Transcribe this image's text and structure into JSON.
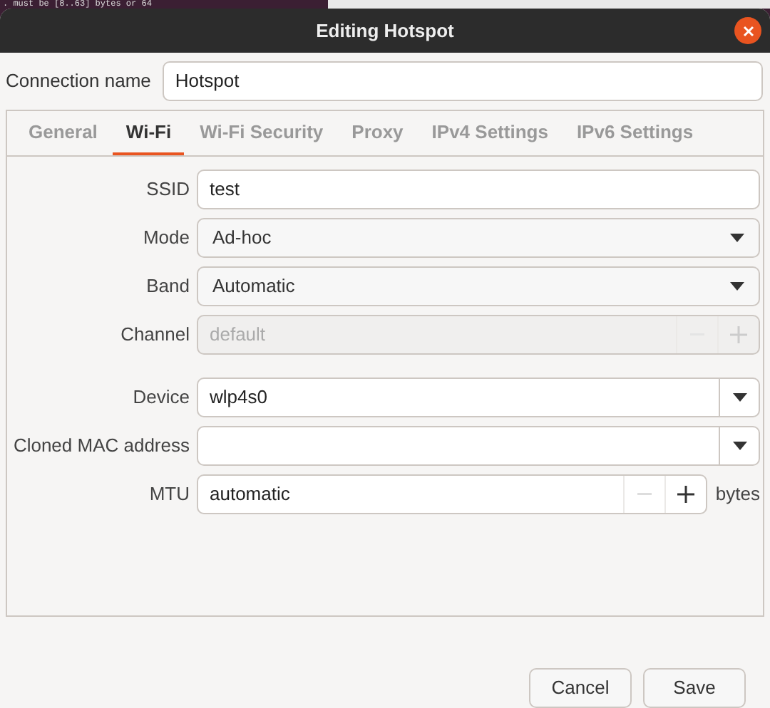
{
  "background_terminal": {
    "text": ". must be [8..63] bytes or 64"
  },
  "window": {
    "title": "Editing Hotspot"
  },
  "connection_name": {
    "label": "Connection name",
    "value": "Hotspot"
  },
  "tabs": [
    {
      "label": "General",
      "selected": false
    },
    {
      "label": "Wi-Fi",
      "selected": true
    },
    {
      "label": "Wi-Fi Security",
      "selected": false
    },
    {
      "label": "Proxy",
      "selected": false
    },
    {
      "label": "IPv4 Settings",
      "selected": false
    },
    {
      "label": "IPv6 Settings",
      "selected": false
    }
  ],
  "fields": [
    {
      "kind": "text",
      "label": "SSID",
      "value": "test"
    },
    {
      "kind": "combo",
      "label": "Mode",
      "value": "Ad-hoc"
    },
    {
      "kind": "combo",
      "label": "Band",
      "value": "Automatic"
    },
    {
      "kind": "spin",
      "label": "Channel",
      "placeholder": "default",
      "disabled": true
    },
    {
      "kind": "combo_entry",
      "label": "Device",
      "value": "wlp4s0"
    },
    {
      "kind": "combo_entry",
      "label": "Cloned MAC address"
    },
    {
      "kind": "spin",
      "label": "MTU",
      "value": "automatic",
      "disabled": false,
      "decrement_disabled": true,
      "unit": "bytes"
    }
  ],
  "buttons": [
    {
      "label": "Cancel"
    },
    {
      "label": "Save"
    }
  ]
}
